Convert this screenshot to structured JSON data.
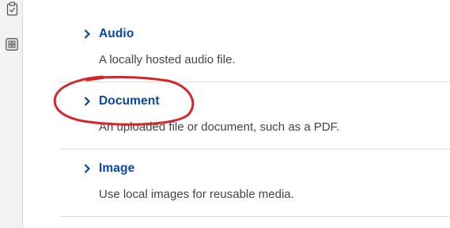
{
  "toolbar": {
    "icons": [
      "clipboard-check-icon",
      "grid-icon"
    ]
  },
  "media_types": [
    {
      "label": "Audio",
      "description": "A locally hosted audio file."
    },
    {
      "label": "Document",
      "description": "An uploaded file or document, such as a PDF."
    },
    {
      "label": "Image",
      "description": "Use local images for reusable media."
    }
  ],
  "colors": {
    "link": "#0747a6",
    "annotation_circle": "#d3262b",
    "toolbar_bg": "#f3f3f3"
  }
}
